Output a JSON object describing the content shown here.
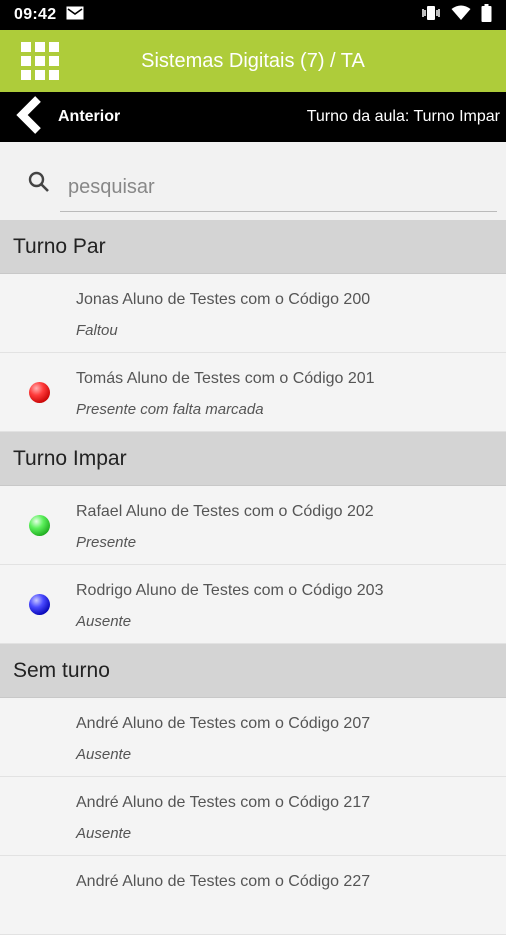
{
  "status_bar": {
    "time": "09:42",
    "icons": [
      "gmail-icon",
      "vibrate-icon",
      "wifi-icon",
      "battery-icon"
    ]
  },
  "app_bar": {
    "title": "Sistemas Digitais (7) / TA",
    "menu_icon": "grid-menu-icon",
    "background_color": "#aecc3a"
  },
  "nav_bar": {
    "back_label": "Anterior",
    "turno_label": "Turno da aula: Turno Impar"
  },
  "search": {
    "placeholder": "pesquisar",
    "value": ""
  },
  "sections": [
    {
      "title": "Turno Par",
      "students": [
        {
          "name": "Jonas Aluno de Testes com o Código 200",
          "status": "Faltou",
          "dot": null
        },
        {
          "name": "Tomás Aluno de Testes com o Código 201",
          "status": "Presente com falta marcada",
          "dot": "red"
        }
      ]
    },
    {
      "title": "Turno Impar",
      "students": [
        {
          "name": "Rafael Aluno de Testes com o Código 202",
          "status": "Presente",
          "dot": "green"
        },
        {
          "name": "Rodrigo Aluno de Testes com o Código 203",
          "status": "Ausente",
          "dot": "blue"
        }
      ]
    },
    {
      "title": "Sem turno",
      "students": [
        {
          "name": "André Aluno de Testes com o Código 207",
          "status": "Ausente",
          "dot": null
        },
        {
          "name": "André Aluno de Testes com o Código 217",
          "status": "Ausente",
          "dot": null
        },
        {
          "name": "André Aluno de Testes com o Código 227",
          "status": "",
          "dot": null
        }
      ]
    }
  ]
}
